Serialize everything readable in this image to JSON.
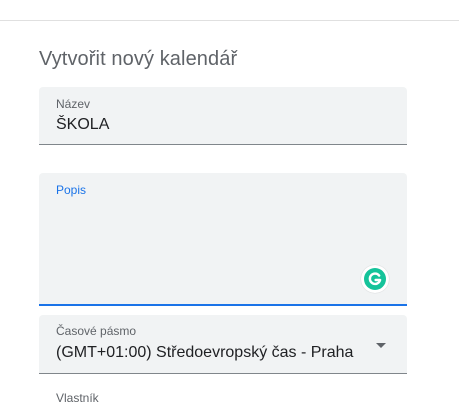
{
  "form": {
    "heading": "Vytvořit nový kalendář",
    "name_field": {
      "label": "Název",
      "value": "ŠKOLA"
    },
    "description_field": {
      "label": "Popis",
      "value": ""
    },
    "timezone_field": {
      "label": "Časové pásmo",
      "value": "(GMT+01:00) Středoevropský čas - Praha"
    },
    "owner_label": "Vlastník"
  },
  "icons": {
    "grammarly": "grammarly-icon",
    "dropdown": "chevron-down-icon"
  },
  "colors": {
    "accent": "#1a73e8",
    "field_background": "#f1f3f4",
    "grammarly_green": "#15c39a"
  }
}
